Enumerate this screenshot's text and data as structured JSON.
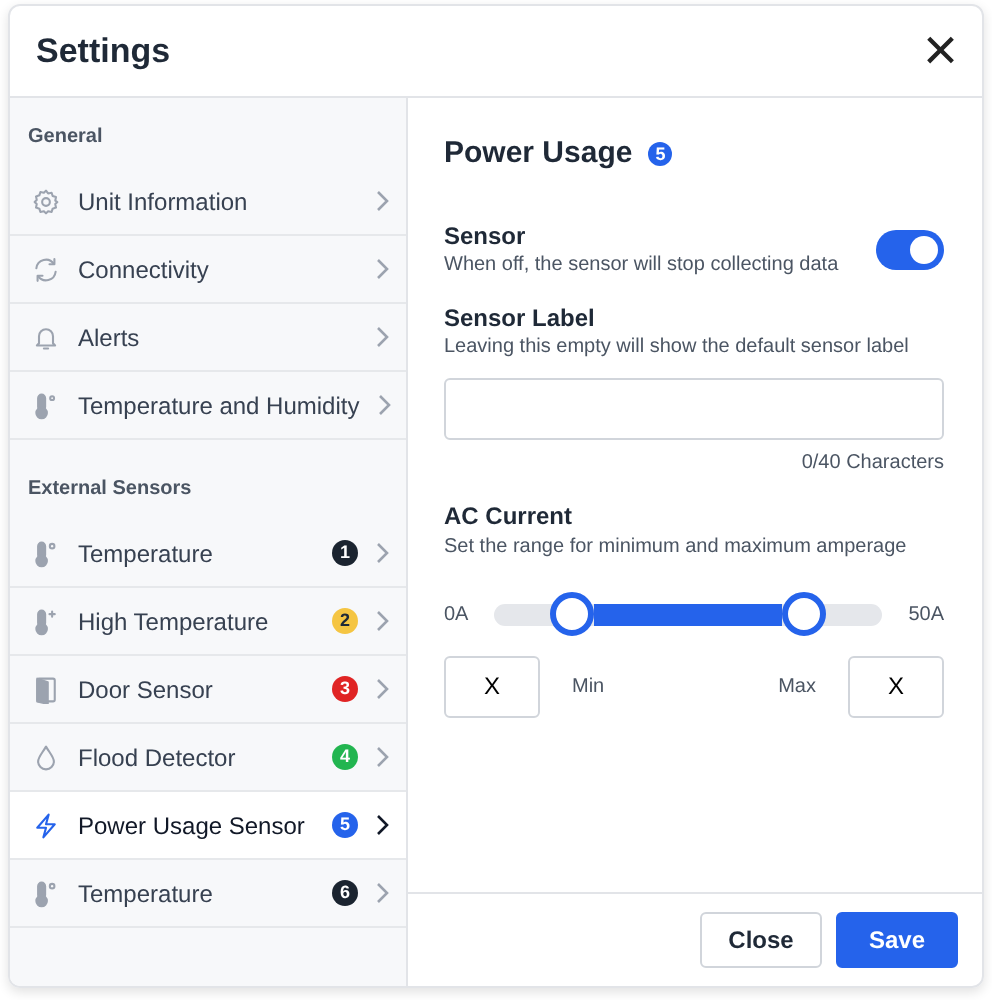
{
  "window": {
    "title": "Settings",
    "close": "×"
  },
  "sidebar": {
    "sections": [
      {
        "heading": "General",
        "items": [
          {
            "label": "Unit Information",
            "selected": false
          },
          {
            "label": "Connectivity",
            "selected": false
          },
          {
            "label": "Alerts",
            "selected": false
          },
          {
            "label": "Temperature and Humidity",
            "selected": false
          }
        ]
      },
      {
        "heading": "External Sensors",
        "items": [
          {
            "label": "Temperature",
            "badge": "1",
            "color": "#1b2430",
            "selected": false
          },
          {
            "label": "High Temperature",
            "badge": "2",
            "color": "#f5c542",
            "selected": false
          },
          {
            "label": "Door Sensor",
            "badge": "3",
            "color": "#e02424",
            "selected": false
          },
          {
            "label": "Flood Detector",
            "badge": "4",
            "color": "#22b550",
            "selected": false
          },
          {
            "label": "Power Usage Sensor",
            "badge": "5",
            "color": "#2563eb",
            "selected": true
          },
          {
            "label": "Temperature",
            "badge": "6",
            "color": "#1b2430",
            "selected": false
          }
        ]
      }
    ]
  },
  "panel": {
    "title": "Power Usage",
    "badge": "5",
    "sensor": {
      "label": "Sensor",
      "hint": "When off, the sensor will stop collecting data",
      "on": true
    },
    "sensor_label": {
      "label": "Sensor Label",
      "hint": "Leaving this empty will show the default sensor label",
      "counter": "0/40 Characters"
    },
    "ac_current": {
      "label": "AC Current",
      "hint": "Set the range for minimum and maximum amperage",
      "min_label": "0A",
      "max_label": "50A",
      "low": {
        "level": 0.2
      },
      "high": {
        "level": 0.8
      },
      "min": {
        "value": "X",
        "caption": "Min"
      },
      "max": {
        "value": "X",
        "caption": "Max"
      }
    }
  },
  "footer": {
    "buttons": [
      {
        "label": "Close",
        "kind": "secondary"
      },
      {
        "label": "Save",
        "kind": "primary"
      }
    ]
  }
}
